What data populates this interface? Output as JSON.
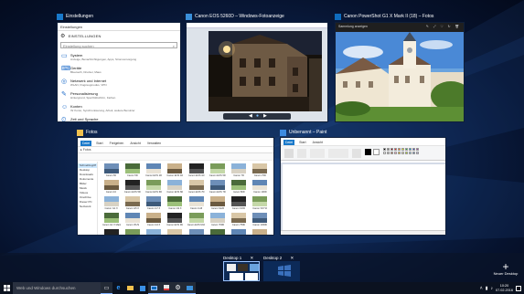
{
  "windows": {
    "settings": {
      "title": "Einstellungen",
      "header": "Einstellungen",
      "section": "EINSTELLUNGEN",
      "search_placeholder": "Einstellung suchen",
      "items": [
        {
          "icon": "display-icon",
          "title": "System",
          "desc": "Anzeige, Benachrichtigungen, Apps, Stromversorgung"
        },
        {
          "icon": "devices-icon",
          "title": "Geräte",
          "desc": "Bluetooth, Drucker, Maus"
        },
        {
          "icon": "network-icon",
          "title": "Netzwerk und Internet",
          "desc": "WLAN, Flugzeugmodus, VPN"
        },
        {
          "icon": "personalization-icon",
          "title": "Personalisierung",
          "desc": "Hintergrund, Sperrbildschirm, Farben"
        },
        {
          "icon": "accounts-icon",
          "title": "Konten",
          "desc": "Ihr Konto, Synchronisierung, Arbeit, weitere Benutzer"
        },
        {
          "icon": "time-language-icon",
          "title": "Zeit und Sprache",
          "desc": "Spracherkennung, Region, Datum"
        }
      ]
    },
    "photo_viewer": {
      "title": "Canon EOS 5260D – Windows-Fotoanzeige"
    },
    "photos_app": {
      "title": "Canon PowerShot G1 X Mark II (18) – Fotos",
      "toolbar_title": "Sammlung anzeigen"
    },
    "explorer": {
      "title": "Fotos",
      "tabs": [
        "Datei",
        "Start",
        "Freigeben",
        "Ansicht",
        "Verwalten"
      ],
      "address": "Fotos",
      "sidebar": [
        "Schnellzugriff",
        "Desktop",
        "Downloads",
        "Dokumente",
        "Bilder",
        "Musik",
        "Videos",
        "OneDrive",
        "Dieser PC",
        "Netzwerk"
      ],
      "thumbs": [
        "Canon 5D",
        "Canon 5D",
        "Canon EOS 1D",
        "Canon EOS 1D",
        "Canon EOS 1D",
        "Canon EOS 5D",
        "Canon 7D",
        "Canon 70D",
        "Canon 1D",
        "Canon EOS 5D",
        "Canon EOS 6D",
        "Canon EOS 6D",
        "Canon EOS 7D",
        "Canon EOS 7D",
        "Canon 80D",
        "Canon 100D",
        "Canon G1 X",
        "Canon G5 X",
        "Canon G7 X",
        "Canon G9 X",
        "Canon G16",
        "Canon S120",
        "Canon SX60",
        "Canon SX710",
        "Canon G1 X Mark II",
        "Canon IXUS",
        "Canon G3 X",
        "Canon EOS M3",
        "Canon EOS M10",
        "Canon 760D",
        "Canon 750D",
        "Canon 1300D",
        "Canon IXUS 285",
        "Canon SX410",
        "Canon SX530",
        "Canon SX720",
        "Canon G5",
        "Canon G9",
        "Canon G7",
        "Canon M"
      ]
    },
    "paint": {
      "title": "Unbenannt – Paint",
      "tabs": [
        "Datei",
        "Start",
        "Ansicht"
      ]
    }
  },
  "virtual_desktops": {
    "desktops": [
      {
        "label": "Desktop 1",
        "active": true
      },
      {
        "label": "Desktop 2",
        "active": false
      }
    ],
    "new_desktop_label": "Neuer Desktop"
  },
  "taskbar": {
    "search_placeholder": "Web und Windows durchsuchen",
    "time": "10:20",
    "date": "07.02.2016",
    "apps": [
      "task-view-icon",
      "edge-icon",
      "explorer-icon",
      "store-icon",
      "photos-icon",
      "paint-icon",
      "settings-icon",
      "photo-viewer-icon"
    ]
  },
  "colors": {
    "accent": "#1979ca",
    "close_red": "#c42b1c"
  }
}
